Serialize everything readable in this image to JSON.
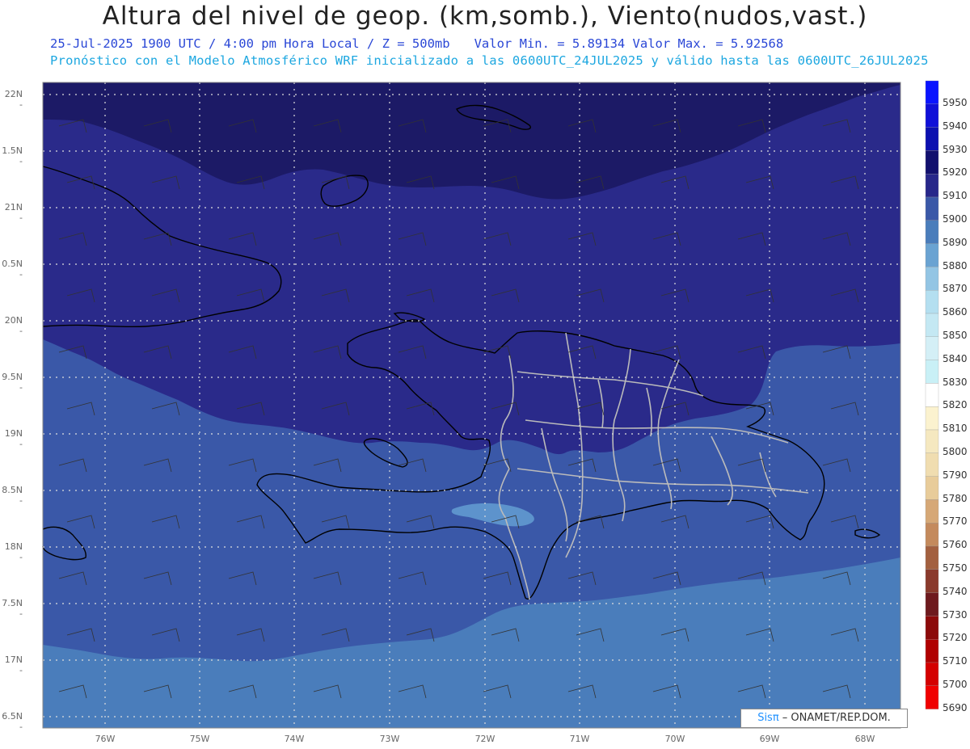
{
  "header": {
    "title": "Altura del nivel de geop. (km,somb.), Viento(nudos,vast.)",
    "valid_time": "25-Jul-2025   1900 UTC / 4:00 pm Hora Local / Z = 500mb",
    "min_max": "Valor Min. = 5.89134  Valor Max. = 5.92568",
    "model_info": "Pronóstico con el Modelo Atmosférico WRF inicializado a las 0600UTC_24JUL2025 y válido hasta las  0600UTC_26JUL2025"
  },
  "map": {
    "lat_labels": [
      "22N",
      "1.5N",
      "21N",
      "0.5N",
      "20N",
      "9.5N",
      "19N",
      "8.5N",
      "18N",
      "7.5N",
      "17N",
      "6.5N"
    ],
    "lon_labels": [
      "76W",
      "75W",
      "74W",
      "73W",
      "72W",
      "71W",
      "70W",
      "69W",
      "68W"
    ],
    "colors": {
      "level_5920_plus": "#1c1a66",
      "level_5910": "#2a2a8a",
      "level_5900": "#3a58a8",
      "level_5890": "#4a7dbb",
      "level_5880": "#5d93cc",
      "coastline": "#000000",
      "province_borders": "#bbbbbb",
      "grid": "#dddddd"
    }
  },
  "colorbar": {
    "labels": [
      "5950",
      "5940",
      "5930",
      "5920",
      "5910",
      "5900",
      "5890",
      "5880",
      "5870",
      "5860",
      "5850",
      "5840",
      "5830",
      "5820",
      "5810",
      "5800",
      "5790",
      "5780",
      "5770",
      "5760",
      "5750",
      "5740",
      "5730",
      "5720",
      "5710",
      "5700",
      "5690"
    ],
    "colors": [
      "#0a14ff",
      "#1010d8",
      "#0c10b0",
      "#12106e",
      "#27278a",
      "#3a58a8",
      "#4a7dbb",
      "#6aa3d2",
      "#93c5e4",
      "#b4dff0",
      "#c4e8f3",
      "#d4eff6",
      "#c9f0f6",
      "#ffffff",
      "#fbf2cf",
      "#f5e8c0",
      "#f0ddb0",
      "#e8cc9a",
      "#d6a876",
      "#c48a5c",
      "#a3603f",
      "#8a3a2c",
      "#6e1a1e",
      "#8c0a0a",
      "#b00000",
      "#d40000",
      "#f00000"
    ]
  },
  "credit": {
    "brand": "Sisπ",
    "text": " – ONAMET/REP.DOM."
  }
}
